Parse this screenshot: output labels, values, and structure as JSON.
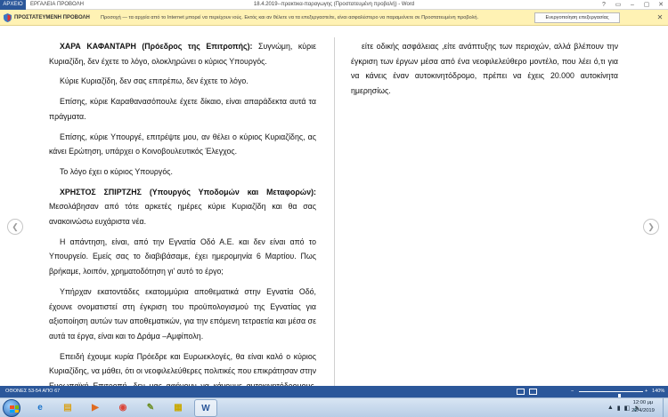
{
  "window": {
    "file_tab": "ΑΡΧΕΙΟ",
    "tabs": [
      "ΕΡΓΑΛΕΙΑ",
      "ΠΡΟΒΟΛΗ"
    ],
    "title": "18.4.2019--πρακτικα-παραγωγης (Προστατευμένη προβολή) - Word",
    "controls": [
      "?",
      "▭",
      "–",
      "▢",
      "✕"
    ]
  },
  "protected_view": {
    "label": "ΠΡΟΣΤΑΤΕΥΜΕΝΗ ΠΡΟΒΟΛΗ",
    "message": "Προσοχή — τα αρχεία από το Internet μπορεί να περιέχουν ιούς. Εκτός και αν θέλετε να τα επεξεργαστείτε, είναι ασφαλέστερο να παραμείνετε σε Προστατευμένη προβολή.",
    "enable_button": "Ενεργοποίηση επεξεργασίας",
    "close": "✕",
    "bar_color": "#fff2b4"
  },
  "document": {
    "left_column": [
      {
        "speaker": "ΧΑΡΑ ΚΑΦΑΝΤΑΡΗ (Πρόεδρος της Επιτροπής):",
        "text": " Συγνώμη, κύριε Κυριαζίδη, δεν έχετε το λόγο, ολοκληρώνει ο κύριος Υπουργός."
      },
      {
        "speaker": "",
        "text": "Κύριε Κυριαζίδη, δεν σας επιτρέπω, δεν έχετε το λόγο."
      },
      {
        "speaker": "",
        "text": "Επίσης, κύριε Καραθανασόπουλε έχετε δίκαιο, είναι απαράδεκτα αυτά τα πράγματα."
      },
      {
        "speaker": "",
        "text": "Επίσης, κύριε Υπουργέ, επιτρέψτε μου, αν θέλει ο κύριος Κυριαζίδης, ας κάνει Ερώτηση, υπάρχει ο Κοινοβουλευτικός Έλεγχος."
      },
      {
        "speaker": "",
        "text": "Το λόγο έχει ο κύριος Υπουργός."
      },
      {
        "speaker": "ΧΡΗΣΤΟΣ ΣΠΙΡΤΖΗΣ (Υπουργός Υποδομών και Μεταφορών):",
        "text": " Μεσολάβησαν από τότε αρκετές ημέρες κύριε Κυριαζίδη και θα σας ανακοινώσω ευχάριστα νέα."
      },
      {
        "speaker": "",
        "text": "Η απάντηση, είναι, από την Εγνατία Οδό Α.Ε. και δεν είναι από το Υπουργείο. Εμείς σας το διαβιβάσαμε, έχει ημερομηνία 6 Μαρτίου. Πως βρήκαμε, λοιπόν, χρηματοδότηση γι' αυτό το έργο;"
      },
      {
        "speaker": "",
        "text": "Υπήρχαν εκατοντάδες εκατομμύρια αποθεματικά στην Εγνατία Οδό, έχουνε ονοματιστεί στη έγκριση του προϋπολογισμού της Εγνατίας για αξιοποίηση αυτών των αποθεματικών, για την επόμενη τετραετία και μέσα σε αυτά τα έργα, είναι και το Δράμα –Αμφίπολη."
      },
      {
        "speaker": "",
        "text": "Επειδή έχουμε κυρία Πρόεδρε και Ευρωεκλογές, θα είναι καλό ο κύριος Κυριαζίδης, να μάθει, ότι οι νεοφιλελεύθερες πολιτικές που επικράτησαν στην Ευρωπαϊκή Επιτροπή, δεν μας αφήνουν να κάνουμε αυτοκινητόδρομους, δρόμους και συνδέσεις, εκεί που υπάρχει ανάγκη,"
      }
    ],
    "right_column": [
      {
        "speaker": "",
        "text": "είτε οδικής ασφάλειας ,είτε ανάπτυξης των περιοχών, αλλά βλέπουν την έγκριση των έργων μέσα από ένα νεοφιλελεύθερο μοντέλο, που λέει ό,τι για να κάνεις έναν αυτοκινητόδρομο, πρέπει να έχεις 20.000 αυτοκίνητα ημερησίως."
      }
    ],
    "nav": {
      "prev": "❮",
      "next": "❯"
    }
  },
  "status": {
    "pages": "ΟΘΟΝΕΣ 53-54 ΑΠΟ 67",
    "zoom_minus": "−",
    "zoom_plus": "+",
    "zoom_level": "140%",
    "zoom_fraction": 0.62,
    "bar_color": "#2b579a"
  },
  "taskbar": {
    "apps": [
      "ie-icon",
      "folder-icon",
      "media-player-icon",
      "chrome-icon",
      "paint-icon",
      "sticky-icon",
      "word-icon"
    ],
    "app_glyphs": [
      "e",
      "▤",
      "▶",
      "◉",
      "✎",
      "▦",
      "W"
    ],
    "tray": [
      "▲",
      "▮",
      "◧",
      "🔊"
    ],
    "time": "12:00 μμ",
    "date": "22/4/2019"
  }
}
